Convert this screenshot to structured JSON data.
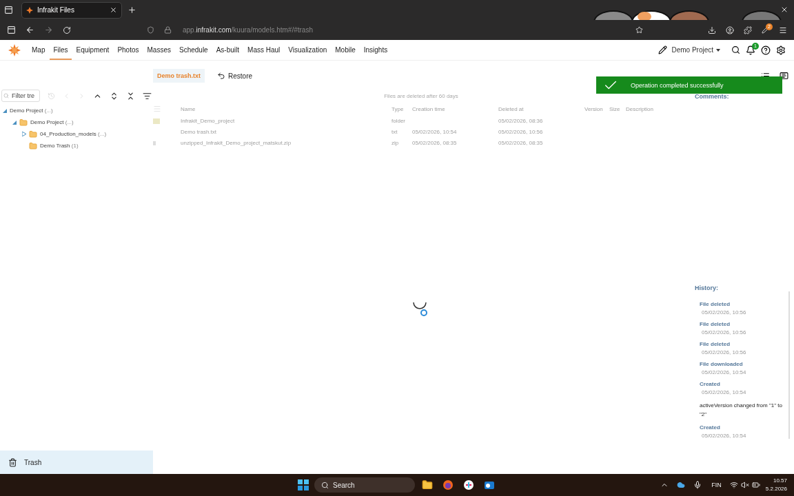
{
  "browser": {
    "tab_title": "Infrakit Files",
    "url": {
      "prefix": "app.",
      "domain": "infrakit.com",
      "path": "/kuura/models.htm#/#trash"
    },
    "extension_badge": "2"
  },
  "nav": {
    "items": [
      {
        "label": "Map",
        "selected": false
      },
      {
        "label": "Files",
        "selected": true
      },
      {
        "label": "Equipment",
        "selected": false
      },
      {
        "label": "Photos",
        "selected": false
      },
      {
        "label": "Masses",
        "selected": false
      },
      {
        "label": "Schedule",
        "selected": false
      },
      {
        "label": "As-built",
        "selected": false
      },
      {
        "label": "Mass Haul",
        "selected": false
      },
      {
        "label": "Visualization",
        "selected": false
      },
      {
        "label": "Mobile",
        "selected": false
      },
      {
        "label": "Insights",
        "selected": false
      }
    ],
    "project": "Demo Project",
    "notification_count": "1"
  },
  "breadcrumb": {
    "current": "Demo trash.txt",
    "restore": "Restore"
  },
  "tree_filter": {
    "placeholder": "Filter tre"
  },
  "tree": [
    {
      "label": "Demo Project",
      "count": "(...)",
      "expanded": true,
      "folder": false,
      "children": [
        {
          "label": "Demo Project",
          "count": "(...)",
          "expanded": true,
          "folder": true,
          "children": [
            {
              "label": "04_Production_models",
              "count": "(...)",
              "expanded": false,
              "folder": true
            },
            {
              "label": "Demo Trash",
              "count": "(1)",
              "folder": true
            }
          ]
        }
      ]
    }
  ],
  "sidebar_footer": {
    "label": "Trash",
    "selected": true
  },
  "table": {
    "notice": "Files are deleted after 60 days",
    "columns": [
      "Name",
      "Type",
      "Creation time",
      "Deleted at",
      "Version",
      "Size",
      "Description"
    ],
    "rows": [
      {
        "kind": "folder",
        "cells": [
          "Infrakit_Demo_project",
          "folder",
          "",
          "05/02/2026, 08:36",
          "",
          "",
          ""
        ]
      },
      {
        "kind": "file",
        "cells": [
          "Demo trash.txt",
          "txt",
          "05/02/2026, 10:54",
          "05/02/2026, 10:56",
          "",
          "",
          ""
        ]
      },
      {
        "kind": "zip",
        "cells": [
          "unzipped_Infrakit_Demo_project_matskut.zip",
          "zip",
          "05/02/2026, 08:35",
          "05/02/2026, 08:35",
          "",
          "",
          ""
        ]
      }
    ]
  },
  "toast": {
    "message": "Operation completed successfully"
  },
  "details": {
    "comments_title": "Comments:",
    "history_title": "History:",
    "history": [
      {
        "title": "File deleted",
        "time": "05/02/2026, 10:56"
      },
      {
        "title": "File deleted",
        "time": "05/02/2026, 10:56"
      },
      {
        "title": "File deleted",
        "time": "05/02/2026, 10:56"
      },
      {
        "title": "File downloaded",
        "time": "05/02/2026, 10:54"
      },
      {
        "title": "Created",
        "time": "05/02/2026, 10:54",
        "note": "activeVersion changed from \"1\" to \"2\""
      },
      {
        "title": "Created",
        "time": "05/02/2026, 10:54"
      }
    ]
  },
  "taskbar": {
    "search": "Search",
    "language": "FIN",
    "time": "10.57",
    "date": "5.2.2026"
  }
}
